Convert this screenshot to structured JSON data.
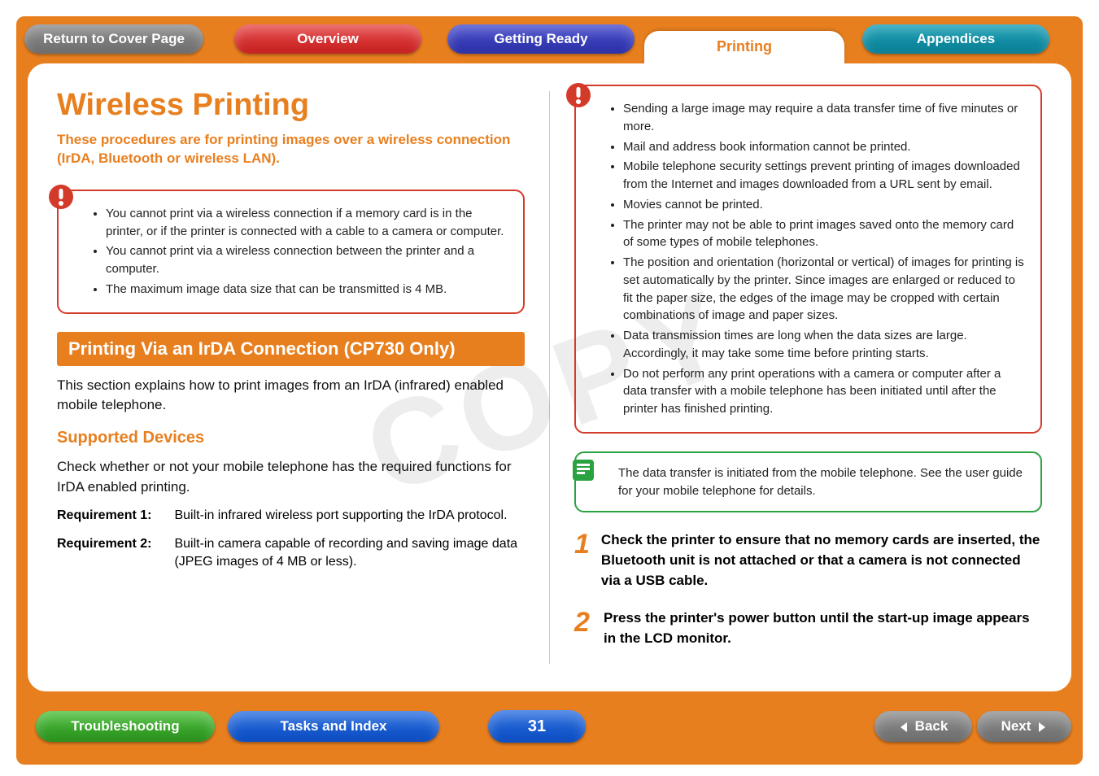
{
  "nav": {
    "return": "Return to Cover Page",
    "overview": "Overview",
    "getting_ready": "Getting Ready",
    "printing": "Printing",
    "appendices": "Appendices"
  },
  "watermark": "COPY",
  "title": "Wireless Printing",
  "lede": "These procedures are for printing images over a wireless connection (IrDA, Bluetooth or wireless LAN).",
  "warn_left": [
    "You cannot print via a wireless connection if a memory card is in the printer, or if the printer is connected with a cable to a camera or computer.",
    "You cannot print via a wireless connection between the printer and a computer.",
    "The maximum image data size that can be transmitted is 4 MB."
  ],
  "section_heading": "Printing Via an IrDA Connection (CP730 Only)",
  "section_intro": "This section explains how to print images from an IrDA (infrared) enabled mobile telephone.",
  "sub_supported": "Supported Devices",
  "supported_text": "Check whether or not your mobile telephone has the required functions for IrDA enabled printing.",
  "req": [
    {
      "label": "Requirement 1:",
      "value": "Built-in infrared wireless port supporting the IrDA protocol."
    },
    {
      "label": "Requirement 2:",
      "value": "Built-in camera capable of recording and saving image data (JPEG images of 4 MB or less)."
    }
  ],
  "warn_right": [
    "Sending a large image may require a data transfer time of five minutes or more.",
    "Mail and address book information cannot be printed.",
    "Mobile telephone security settings prevent printing of images downloaded from the Internet and images downloaded from a URL sent by email.",
    "Movies cannot be printed.",
    "The printer may not be able to print images saved onto the memory card of some types of mobile telephones.",
    "The position and orientation (horizontal or vertical) of images for printing is set automatically by the printer. Since images are enlarged or reduced to fit the paper size, the edges of the image may be cropped with certain combinations of image and paper sizes.",
    "Data transmission times are long when the data sizes are large. Accordingly, it may take some time before printing starts.",
    "Do not perform any print operations with a camera or computer after a data transfer with a mobile telephone has been initiated until after the printer has finished printing."
  ],
  "note_text": "The data transfer is initiated from the mobile telephone. See the user guide for your mobile telephone for details.",
  "steps": [
    {
      "num": "1",
      "text": "Check the printer to ensure that no memory cards are inserted, the Bluetooth unit is not attached or that a camera is not connected via a USB cable."
    },
    {
      "num": "2",
      "text": "Press the printer's power button until the start-up image appears in the LCD monitor."
    }
  ],
  "bottom": {
    "troubleshooting": "Troubleshooting",
    "tasks_index": "Tasks and Index",
    "page": "31",
    "back": "Back",
    "next": "Next"
  }
}
